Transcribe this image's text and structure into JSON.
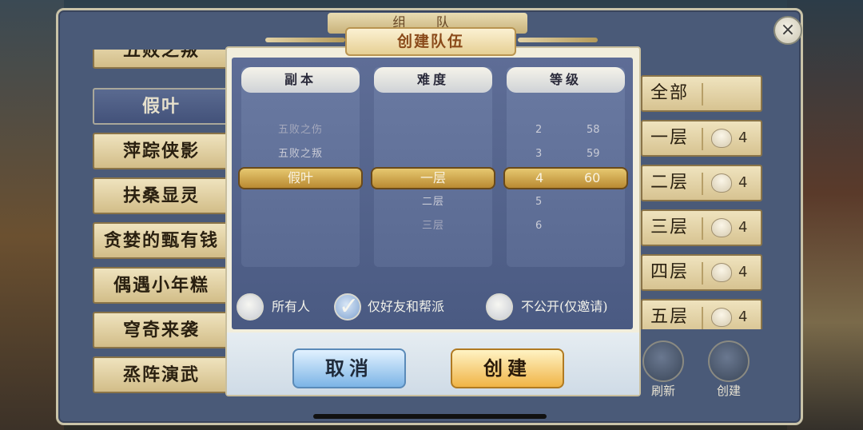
{
  "team_window": {
    "title": "组 队",
    "close_icon": "×"
  },
  "dungeon_list": [
    {
      "label": "五败之叛",
      "selected": false
    },
    {
      "label": "假叶",
      "selected": true
    },
    {
      "label": "萍踪侠影",
      "selected": false
    },
    {
      "label": "扶桑显灵",
      "selected": false
    },
    {
      "label": "贪婪的甄有钱",
      "selected": false
    },
    {
      "label": "偶遇小年糕",
      "selected": false
    },
    {
      "label": "穹奇来袭",
      "selected": false
    },
    {
      "label": "烝阵演武",
      "selected": false
    }
  ],
  "tier_list": {
    "all_label": "全部",
    "rows": [
      {
        "name": "一层",
        "count": "4"
      },
      {
        "name": "二层",
        "count": "4"
      },
      {
        "name": "三层",
        "count": "4"
      },
      {
        "name": "四层",
        "count": "4"
      },
      {
        "name": "五层",
        "count": "4"
      }
    ]
  },
  "side_buttons": {
    "refresh_label": "刷新",
    "create_label": "创建"
  },
  "modal": {
    "title": "创建队伍",
    "columns": {
      "instance": {
        "header": "副本",
        "options_above": [
          "五败之伤",
          "五败之叛"
        ],
        "selected": "假叶"
      },
      "difficulty": {
        "header": "难度",
        "selected": "一层",
        "options_below": [
          "二层",
          "三层"
        ]
      },
      "level": {
        "header": "等级",
        "above": [
          {
            "a": "2",
            "b": "58"
          },
          {
            "a": "3",
            "b": "59"
          }
        ],
        "selected": {
          "a": "4",
          "b": "60"
        },
        "below": [
          "5",
          "6"
        ]
      }
    },
    "visibility": {
      "everyone": "所有人",
      "friends_guild": "仅好友和帮派",
      "private": "不公开(仅邀请)",
      "checked": "friends_guild"
    },
    "cancel_label": "取消",
    "create_label": "创建"
  },
  "colors": {
    "accent_gold": "#e7c870",
    "panel_blue": "#5e6d96",
    "cancel_blue": "#7cb4e6",
    "create_gold": "#f0b446"
  }
}
